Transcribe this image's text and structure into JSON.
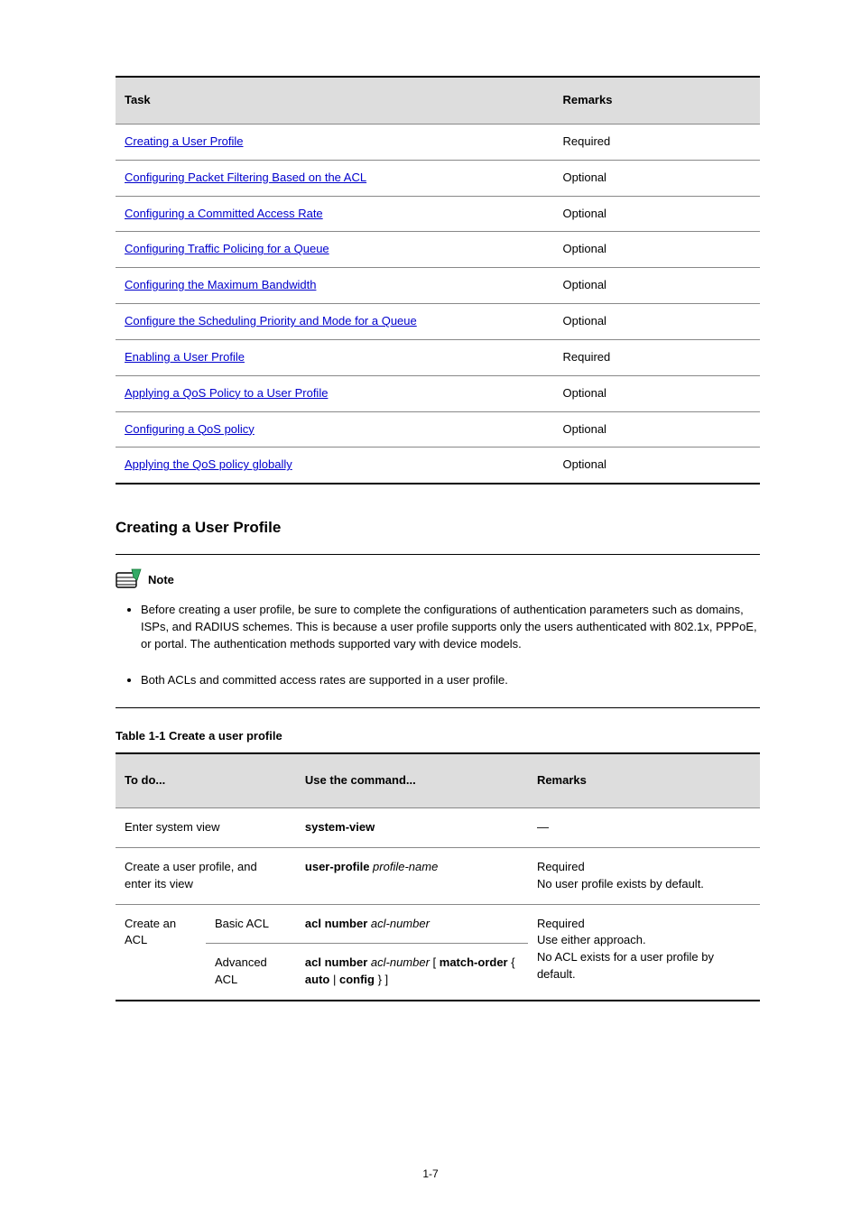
{
  "page_number": "1-7",
  "tasks_table": {
    "headers": {
      "task": "Task",
      "remarks": "Remarks"
    },
    "rows": [
      {
        "link": "Creating a User Profile",
        "remarks": "Required"
      },
      {
        "link": "Configuring Packet Filtering Based on the ACL",
        "remarks": "Optional"
      },
      {
        "link": "Configuring a Committed Access Rate",
        "remarks": "Optional"
      },
      {
        "link": "Configuring Traffic Policing for a Queue",
        "remarks": "Optional"
      },
      {
        "link": "Configuring the Maximum Bandwidth",
        "remarks": "Optional"
      },
      {
        "link": "Configure the Scheduling Priority and Mode for a Queue",
        "remarks": "Optional"
      },
      {
        "link": "Enabling a User Profile",
        "remarks": "Required"
      },
      {
        "link": "Applying a QoS Policy to a User Profile",
        "remarks": "Optional"
      },
      {
        "link": "Configuring a QoS policy",
        "remarks": "Optional"
      },
      {
        "link": "Applying the QoS policy globally",
        "remarks": "Optional"
      }
    ]
  },
  "section": {
    "title": "Creating a User Profile"
  },
  "note": {
    "label": "Note",
    "items": [
      "Before creating a user profile, be sure to complete the configurations of authentication parameters such as domains, ISPs, and RADIUS schemes. This is because a user profile supports only the users authenticated with 802.1x, PPPoE, or portal. The authentication methods supported vary with device models.",
      "Both ACLs and committed access rates are supported in a user profile."
    ]
  },
  "steps_table": {
    "caption": "Table 1-1 Create a user profile",
    "headers": {
      "todo": "To do...",
      "command": "Use the command...",
      "remarks": "Remarks"
    },
    "rows": [
      {
        "todo_span": 2,
        "todo": "Enter system view",
        "command": "system-view",
        "remarks": "—"
      },
      {
        "todo_span": 2,
        "todo": "Create a user profile, and enter its view",
        "command_html": "<span class=\"cmd\">user-profile</span> <i>profile-name</i>",
        "remarks": "Required\nNo user profile exists by default."
      },
      {
        "group_todo": "Create an ACL",
        "group_rowspan": 2,
        "sub_todo": "Basic ACL",
        "command_html": "<span class=\"cmd\">acl number</span> <i>acl-number</i>",
        "remarks_rowspan": 2,
        "remarks": "Required\nUse either approach.\nNo ACL exists for a user profile by default."
      },
      {
        "sub_todo": "Advanced ACL",
        "command_html": "<span class=\"cmd\">acl number</span> <i>acl-number</i> [ <span class=\"cmd\">match-order</span> { <span class=\"cmd\">auto</span> | <span class=\"cmd\">config</span> } ]"
      }
    ]
  }
}
